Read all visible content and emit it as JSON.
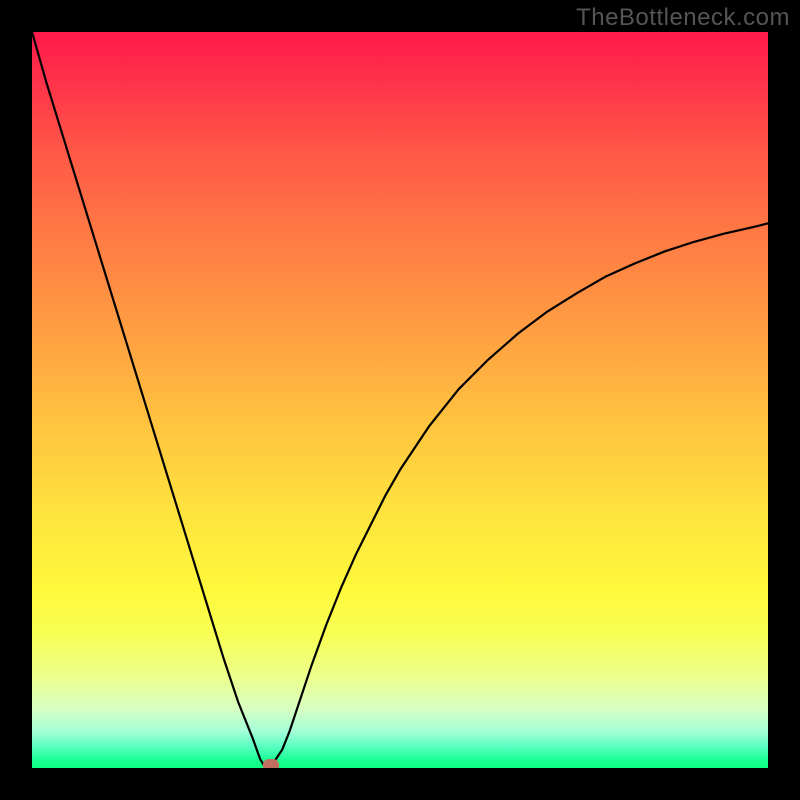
{
  "watermark": "TheBottleneck.com",
  "colors": {
    "top": "#ff1a4a",
    "bottom": "#0eff7f",
    "curve": "#000000",
    "marker": "#c07060",
    "frame": "#000000"
  },
  "chart_data": {
    "type": "line",
    "title": "",
    "xlabel": "",
    "ylabel": "",
    "xlim": [
      0,
      100
    ],
    "ylim": [
      0,
      100
    ],
    "grid": false,
    "x": [
      0,
      2,
      4,
      6,
      8,
      10,
      12,
      14,
      16,
      18,
      20,
      22,
      24,
      26,
      28,
      30,
      31,
      31.5,
      32,
      33,
      34,
      35,
      36,
      38,
      40,
      42,
      44,
      46,
      48,
      50,
      54,
      58,
      62,
      66,
      70,
      74,
      78,
      82,
      86,
      90,
      94,
      98,
      100
    ],
    "values": [
      100,
      93,
      86.5,
      80,
      73.5,
      67,
      60.5,
      54,
      47.5,
      41,
      34.5,
      28,
      21.5,
      15,
      9,
      4,
      1.2,
      0.4,
      0.4,
      1,
      2.5,
      5,
      8,
      14,
      19.5,
      24.5,
      29,
      33,
      37,
      40.5,
      46.5,
      51.5,
      55.5,
      59,
      62,
      64.5,
      66.8,
      68.6,
      70.2,
      71.5,
      72.6,
      73.5,
      74
    ],
    "marker": {
      "x": 32.5,
      "y": 0.4
    },
    "description": "V-shaped bottleneck curve: steep linear descent from (0,100) to a minimum near x≈32, then a decelerating rise toward ~74 at x=100."
  }
}
